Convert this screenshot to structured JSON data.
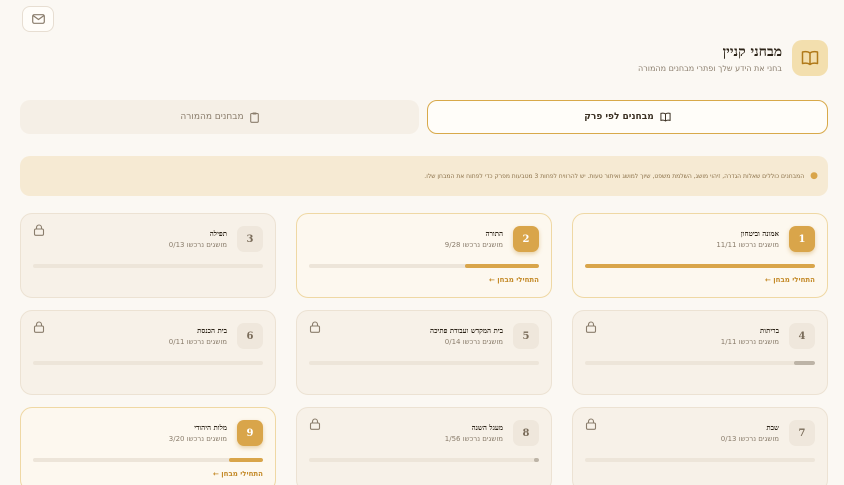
{
  "header": {
    "title": "מבחני קניין",
    "subtitle": "בחני את הידע שלך ופתרי מבחנים מהמורה",
    "logo_icon": "book-icon",
    "mail_icon": "mail-icon"
  },
  "tabs": [
    {
      "label": "מבחנים לפי פרק",
      "icon": "book-icon",
      "active": true
    },
    {
      "label": "מבחנים מהמורה",
      "icon": "clipboard-icon",
      "active": false
    }
  ],
  "notice": {
    "icon": "lightbulb-icon",
    "text": "המבחנים כוללים שאלות הגדרה, זיהוי מושג, השלמת משפט, שיוך למושג ואיתור טעות. יש להרוויח לפחות 3 מטבעות מפרק כדי לפתוח את המבחן שלו."
  },
  "start_label": "התחילי מבחן ←",
  "chapters": [
    {
      "num": "1",
      "name": "אמונה וביטחון",
      "progress": "11/11 מושגים נרכשו",
      "fraction": 1.0,
      "active": true,
      "locked": false
    },
    {
      "num": "2",
      "name": "התורה",
      "progress": "9/28 מושגים נרכשו",
      "fraction": 0.32,
      "active": true,
      "locked": false
    },
    {
      "num": "3",
      "name": "תפילה",
      "progress": "0/13 מושגים נרכשו",
      "fraction": 0.0,
      "active": false,
      "locked": true
    },
    {
      "num": "4",
      "name": "בריתות",
      "progress": "1/11 מושגים נרכשו",
      "fraction": 0.09,
      "active": false,
      "locked": true
    },
    {
      "num": "5",
      "name": "בית המקדש ועבודת פתיכה",
      "progress": "0/14 מושגים נרכשו",
      "fraction": 0.0,
      "active": false,
      "locked": true
    },
    {
      "num": "6",
      "name": "בית הכנסת",
      "progress": "0/11 מושגים נרכשו",
      "fraction": 0.0,
      "active": false,
      "locked": true
    },
    {
      "num": "7",
      "name": "שבת",
      "progress": "0/13 מושגים נרכשו",
      "fraction": 0.0,
      "active": false,
      "locked": true
    },
    {
      "num": "8",
      "name": "מעגל השנה",
      "progress": "1/56 מושגים נרכשו",
      "fraction": 0.02,
      "active": false,
      "locked": true
    },
    {
      "num": "9",
      "name": "מלות היהודי",
      "progress": "3/20 מושגים נרכשו",
      "fraction": 0.15,
      "active": true,
      "locked": false
    }
  ]
}
